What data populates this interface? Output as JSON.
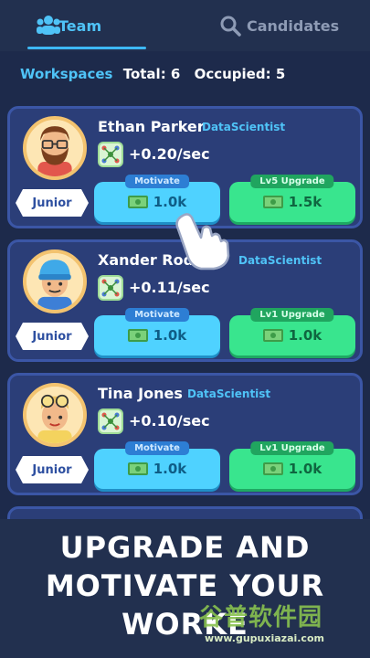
{
  "tabs": {
    "team_label": "Team",
    "candidates_label": "Candidates"
  },
  "stats": {
    "workspaces_label": "Workspaces",
    "total": "Total: 6",
    "occupied": "Occupied: 5"
  },
  "employees": [
    {
      "name": "Ethan Parker",
      "role": "DataScientist",
      "rank": "Junior",
      "rate": "+0.20/sec",
      "motivate_label": "Motivate",
      "motivate_cost": "1.0k",
      "upgrade_label": "Lv5 Upgrade",
      "upgrade_cost": "1.5k"
    },
    {
      "name": "Xander Rodri",
      "role": "DataScientist",
      "rank": "Junior",
      "rate": "+0.11/sec",
      "motivate_label": "Motivate",
      "motivate_cost": "1.0k",
      "upgrade_label": "Lv1 Upgrade",
      "upgrade_cost": "1.0k"
    },
    {
      "name": "Tina Jones",
      "role": "DataScientist",
      "rank": "Junior",
      "rate": "+0.10/sec",
      "motivate_label": "Motivate",
      "motivate_cost": "1.0k",
      "upgrade_label": "Lv1 Upgrade",
      "upgrade_cost": "1.0k"
    }
  ],
  "banner": {
    "text": "UPGRADE AND\nMOTIVATE YOUR\nWORKE"
  },
  "watermark": {
    "cn": "谷普软件园",
    "url": "www.gupuxiazai.com"
  },
  "colors": {
    "background": "#1d2a4b",
    "card": "#2b3e78",
    "accent_blue": "#4fc3f7",
    "motivate_button": "#4fd2ff",
    "upgrade_button": "#39e58e"
  }
}
